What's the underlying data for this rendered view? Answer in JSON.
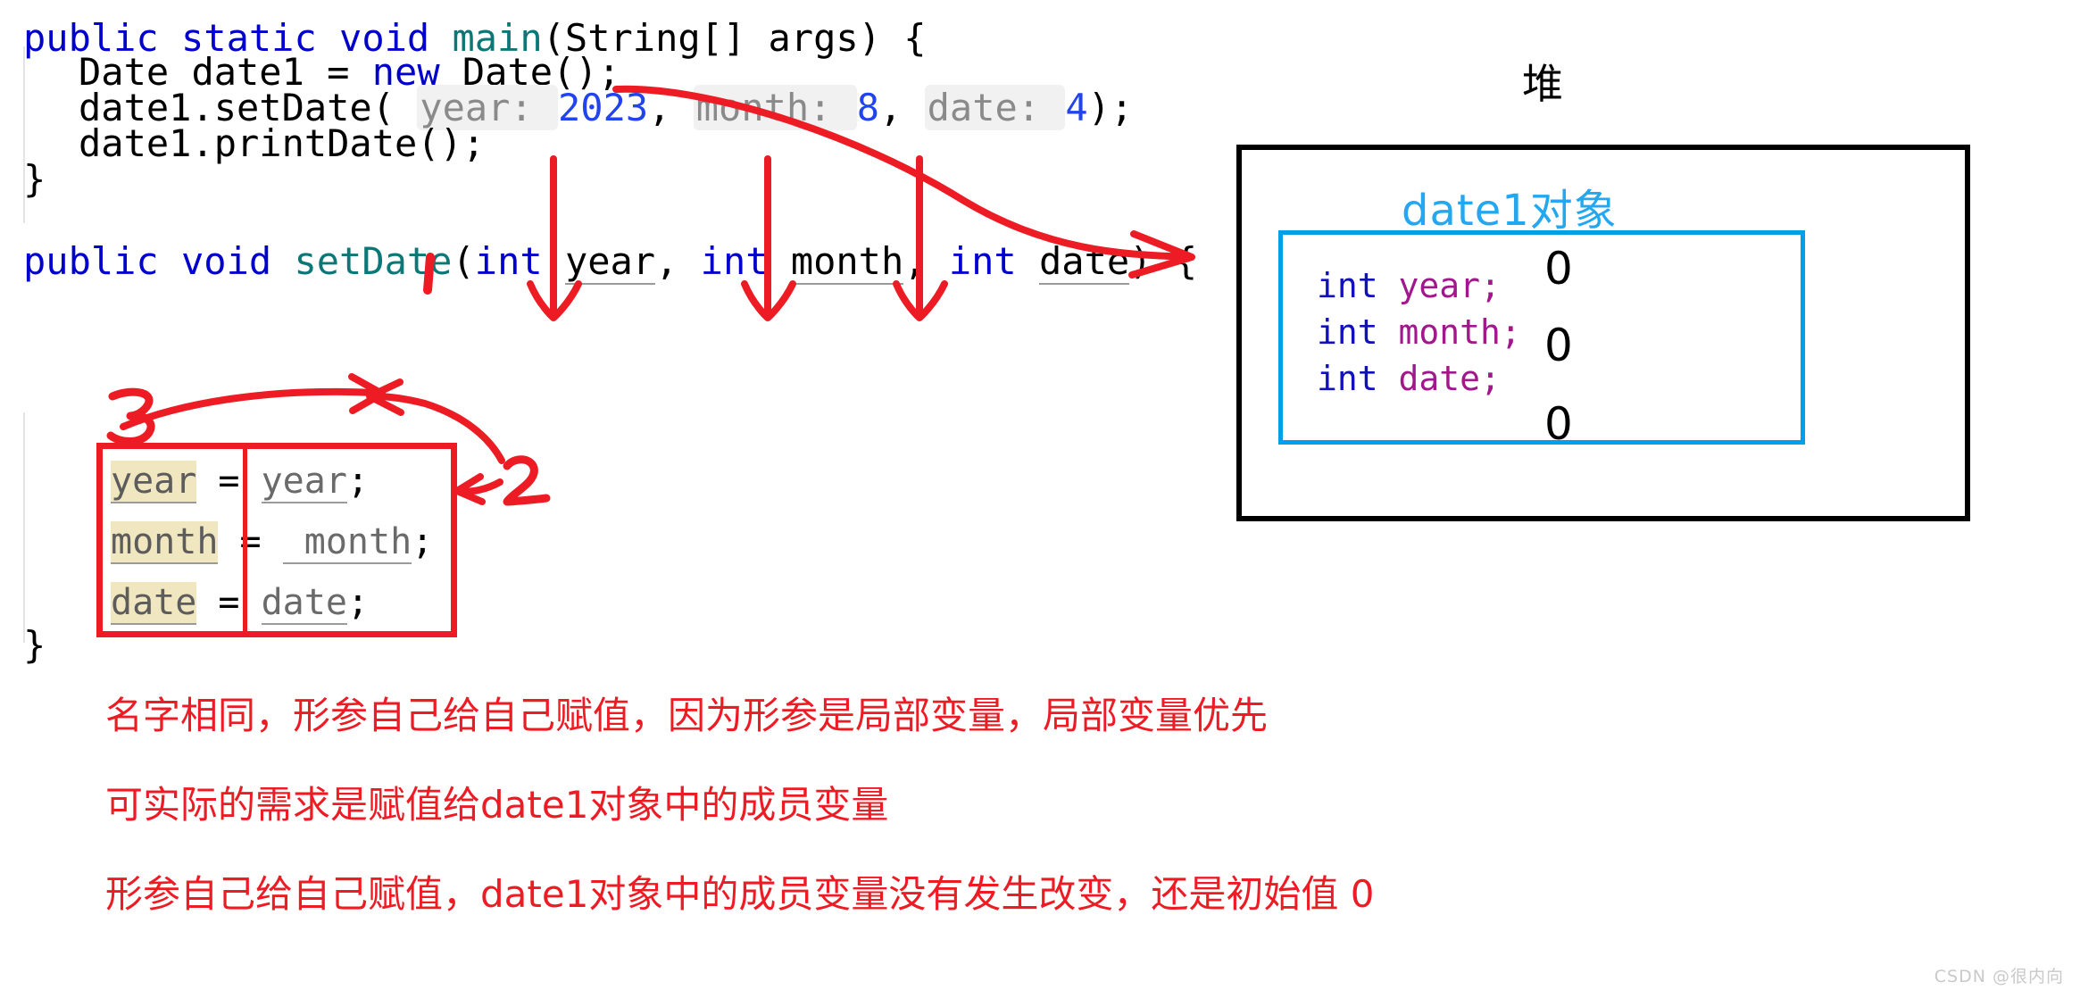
{
  "code": {
    "main_method": {
      "line1": {
        "kw1": "public",
        "kw2": "static",
        "kw3": "void",
        "name": "main",
        "rest": "(String[] args) {"
      },
      "line2": {
        "type": "Date",
        "var": "date1",
        "eq": " = ",
        "kw": "new",
        "call": " Date();"
      },
      "line3": {
        "recv": "date1.setDate( ",
        "hint1": "year: ",
        "val1": "2023",
        "sep1": ", ",
        "hint2": "month: ",
        "val2": "8",
        "sep2": ", ",
        "hint3": "date: ",
        "val3": "4",
        "tail": ");"
      },
      "line4": {
        "text": "date1.printDate();"
      },
      "close": "}"
    },
    "set_date_method": {
      "signature": {
        "kw1": "public",
        "kw2": "void",
        "name": "setDate",
        "open": "(",
        "t1": "int",
        "p1": "year",
        "c1": ", ",
        "t2": "int",
        "p2": "month",
        "c2": ", ",
        "t3": "int",
        "p3": "date",
        "close": ") {"
      },
      "body": [
        {
          "left": "year",
          "op": " = ",
          "right": "year",
          "semi": ";"
        },
        {
          "left": "month",
          "op": " = ",
          "right": " month",
          "semi": ";"
        },
        {
          "left": "date",
          "op": " = ",
          "right": "date",
          "semi": ";"
        }
      ],
      "close": "}"
    }
  },
  "heap": {
    "title": "堆",
    "object_label": "date1对象",
    "fields": [
      {
        "type": "int",
        "name": " year",
        "semi": ";",
        "value": "0"
      },
      {
        "type": "int",
        "name": " month",
        "semi": ";",
        "value": "0"
      },
      {
        "type": "int",
        "name": " date",
        "semi": ";",
        "value": "0"
      }
    ],
    "colors": {
      "outer_border": "#000000",
      "inner_border": "#00A0E9",
      "label": "#22A7F0"
    }
  },
  "annotations": {
    "markers": [
      {
        "id": "1",
        "label": "1"
      },
      {
        "id": "2",
        "label": "2"
      },
      {
        "id": "3",
        "label": "3"
      }
    ],
    "notes": [
      "名字相同，形参自己给自己赋值，因为形参是局部变量，局部变量优先",
      "可实际的需求是赋值给date1对象中的成员变量",
      "形参自己给自己赋值，date1对象中的成员变量没有发生改变，还是初始值 0"
    ],
    "color": "#ED1C24"
  },
  "watermark": "CSDN @很内向"
}
